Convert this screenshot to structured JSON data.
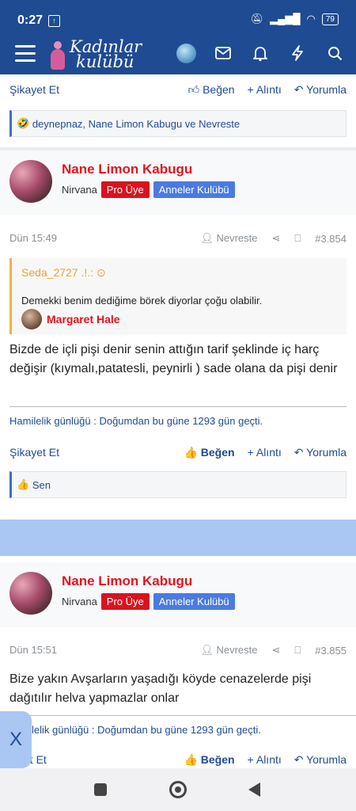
{
  "status": {
    "time": "0:27",
    "battery": "79"
  },
  "nav": {
    "logo_line1": "Kadınlar",
    "logo_line2": "kulübü"
  },
  "post_top": {
    "complain": "Şikayet Et",
    "like": "Beğen",
    "quote": "Alıntı",
    "reply": "Yorumla",
    "reactions": "deynepnaz, Nane Limon Kabugu ve Nevreste"
  },
  "post1": {
    "author": "Nane Limon Kabugu",
    "rank": "Nirvana",
    "badge1": "Pro Üye",
    "badge2": "Anneler Kulübü",
    "date": "Dün 15:49",
    "mention": "Nevreste",
    "number": "#3.854",
    "quote_author": "Seda_2727 .!.:",
    "quote_text": "Demekki benim dediğime börek diyorlar çoğu olabilir.",
    "quote_user": "Margaret Hale",
    "body": "Bizde de içli pişi denir senin attığın tarif şeklinde iç harç değişir (kıymalı,patatesli, peynirli ) sade olana da pişi denir",
    "signature": "Hamilelik günlüğü : Doğumdan bu güne 1293 gün geçti.",
    "complain": "Şikayet Et",
    "like": "Beğen",
    "quote": "Alıntı",
    "reply": "Yorumla",
    "reactions": "Sen"
  },
  "post2": {
    "author": "Nane Limon Kabugu",
    "rank": "Nirvana",
    "badge1": "Pro Üye",
    "badge2": "Anneler Kulübü",
    "date": "Dün 15:51",
    "mention": "Nevreste",
    "number": "#3.855",
    "body": "Bize yakın Avşarların yaşadığı köyde cenazelerde pişi dağıtılır helva yapmazlar onlar",
    "signature": "lelik günlüğü : Doğumdan bu güne 1293 gün geçti.",
    "complain": "et Et",
    "like": "Beğen",
    "quote": "Alıntı",
    "reply": "Yorumla"
  },
  "floating": {
    "close": "X"
  }
}
